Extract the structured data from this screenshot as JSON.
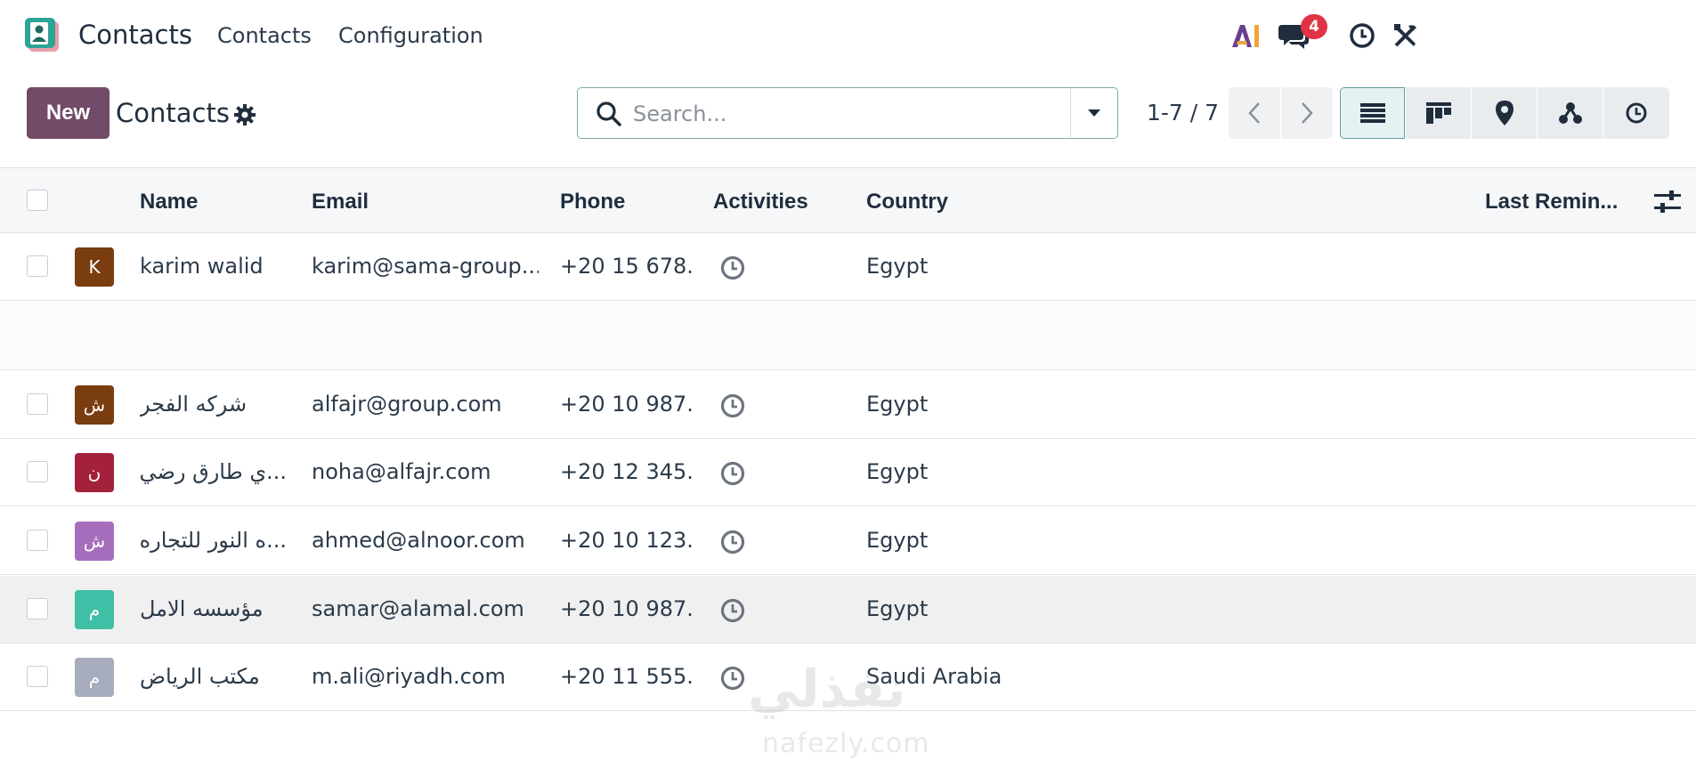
{
  "navbar": {
    "app_name": "Contacts",
    "menu": [
      "Contacts",
      "Configuration"
    ],
    "chat_badge": "4"
  },
  "control_panel": {
    "new_label": "New",
    "title": "Contacts",
    "search_placeholder": "Search...",
    "pager": "1-7 / 7"
  },
  "table": {
    "columns": [
      "Name",
      "Email",
      "Phone",
      "Activities",
      "Country",
      "Last Remin..."
    ],
    "rows": [
      {
        "avatar": "K",
        "avatar_color": "#7a3d10",
        "name": "karim walid",
        "email": "karim@sama-group....",
        "phone": "+20 15 678...",
        "country": "Egypt"
      },
      {
        "avatar": "",
        "avatar_color": "",
        "name": "",
        "email": "",
        "phone": "",
        "country": ""
      },
      {
        "avatar": "ش",
        "avatar_color": "#7a3d10",
        "name": "شركه الفجر",
        "email": "alfajr@group.com",
        "phone": "+20 10 987...",
        "country": "Egypt"
      },
      {
        "avatar": "ن",
        "avatar_color": "#a3213a",
        "name": "...ي طارق رضي",
        "email": "noha@alfajr.com",
        "phone": "+20 12 345...",
        "country": "Egypt"
      },
      {
        "avatar": "ش",
        "avatar_color": "#a76dbd",
        "name": "...ه النور للتجاره",
        "email": "ahmed@alnoor.com",
        "phone": "+20 10 123...",
        "country": "Egypt"
      },
      {
        "avatar": "م",
        "avatar_color": "#3fbfa5",
        "name": "مؤسسه الامل",
        "email": "samar@alamal.com",
        "phone": "+20 10 987...",
        "country": "Egypt"
      },
      {
        "avatar": "م",
        "avatar_color": "#a7adbd",
        "name": "مكتب الرياض",
        "email": "m.ali@riyadh.com",
        "phone": "+20 11 555...",
        "country": "Saudi Arabia"
      }
    ]
  },
  "colors": {
    "brand": "#714b67",
    "accent": "#017e84",
    "badge": "#e03444"
  },
  "icons": [
    "ai-icon",
    "chat-icon",
    "clock-icon",
    "tools-icon",
    "gear-icon",
    "search-icon",
    "list-view-icon",
    "kanban-view-icon",
    "map-view-icon",
    "hierarchy-view-icon",
    "activity-view-icon",
    "activity-clock-icon",
    "optional-columns-icon"
  ],
  "watermark": {
    "text": "نفذلي",
    "domain": "nafezly.com"
  }
}
